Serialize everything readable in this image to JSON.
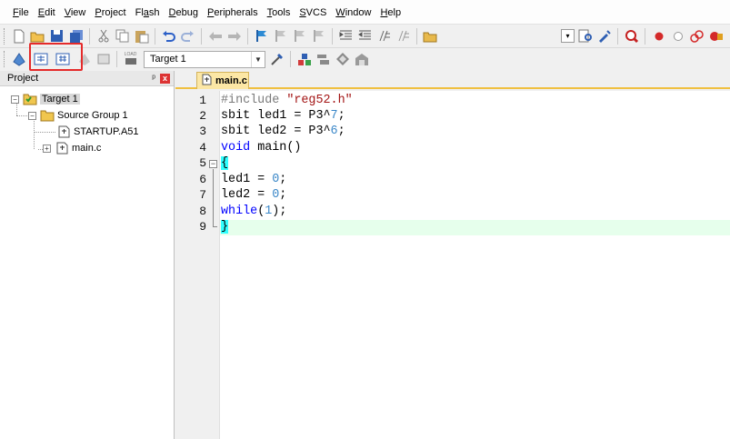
{
  "menu": [
    {
      "mnemonic": "F",
      "rest": "ile"
    },
    {
      "mnemonic": "E",
      "rest": "dit"
    },
    {
      "mnemonic": "V",
      "rest": "iew"
    },
    {
      "mnemonic": "P",
      "rest": "roject"
    },
    {
      "pre": "Fl",
      "mnemonic": "a",
      "rest": "sh"
    },
    {
      "mnemonic": "D",
      "rest": "ebug"
    },
    {
      "mnemonic": "P",
      "rest": "eripherals"
    },
    {
      "mnemonic": "T",
      "rest": "ools"
    },
    {
      "mnemonic": "S",
      "rest": "VCS"
    },
    {
      "mnemonic": "W",
      "rest": "indow"
    },
    {
      "mnemonic": "H",
      "rest": "elp"
    }
  ],
  "toolbar2": {
    "target_select_value": "Target 1",
    "load_label": "LOAD"
  },
  "project_panel": {
    "title": "Project",
    "pin": "ᵖ",
    "close": "x",
    "tree": {
      "target": "Target 1",
      "group": "Source Group 1",
      "files": [
        "STARTUP.A51",
        "main.c"
      ]
    }
  },
  "editor": {
    "tab_label": "main.c",
    "line_numbers": [
      "1",
      "2",
      "3",
      "4",
      "5",
      "6",
      "7",
      "8",
      "9"
    ],
    "lines": {
      "l1_pre": "#include ",
      "l1_str": "\"reg52.h\"",
      "l2_a": "sbit led1 = P3^",
      "l2_num": "7",
      "l2_end": ";",
      "l3_a": "sbit led2 = P3^",
      "l3_num": "6",
      "l3_end": ";",
      "l4_kw": "void",
      "l4_rest": " main()",
      "l5_brace": "{",
      "l6_a": "led1 = ",
      "l6_num": "0",
      "l6_end": ";",
      "l7_a": "led2 = ",
      "l7_num": "0",
      "l7_end": ";",
      "l8_kw": "while",
      "l8_open": "(",
      "l8_num": "1",
      "l8_end": ");",
      "l9_brace": "}"
    }
  },
  "colors": {
    "highlight_box": "#e52a2a",
    "active_tab": "#fce7a5",
    "current_line": "#e6ffec",
    "brace_match": "#33ffff",
    "keyword": "#0000ff",
    "string": "#a31515",
    "number": "#3a87c8"
  }
}
